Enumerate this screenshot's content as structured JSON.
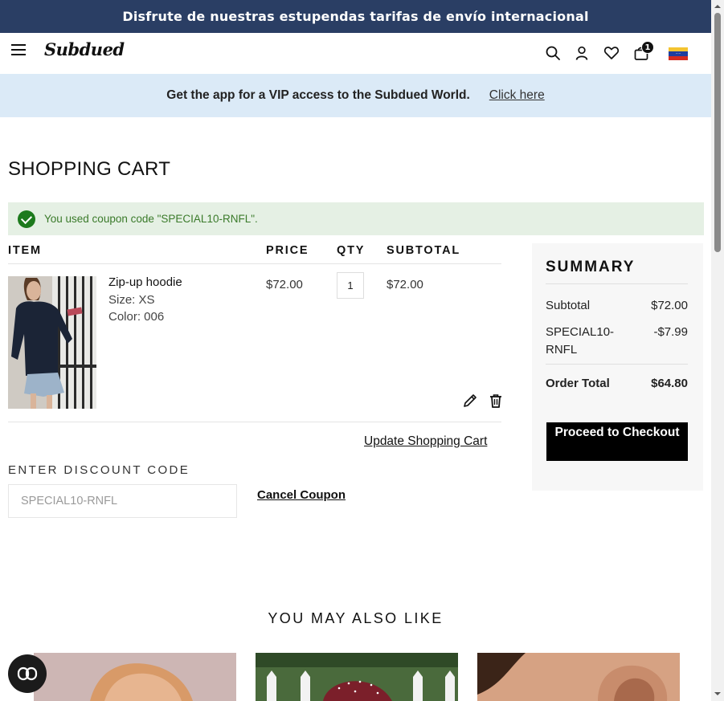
{
  "announcement": "Disfrute de nuestras estupendas tarifas de envío internacional",
  "header": {
    "logo": "Subdued",
    "cart_count": "1",
    "flag_colors": [
      "#f4c430",
      "#1f3e9e",
      "#d52b1e"
    ]
  },
  "app_banner": {
    "text": "Get the app for a VIP access to the Subdued World.",
    "link": "Click here"
  },
  "page": {
    "title": "SHOPPING CART"
  },
  "message": "You used coupon code \"SPECIAL10-RNFL\".",
  "table": {
    "headers": [
      "ITEM",
      "PRICE",
      "QTY",
      "SUBTOTAL"
    ],
    "items": [
      {
        "name": "Zip-up hoodie",
        "size": "Size: XS",
        "color": "Color: 006",
        "price": "$72.00",
        "qty": "1",
        "subtotal": "$72.00"
      }
    ],
    "update_label": "Update Shopping Cart"
  },
  "discount": {
    "title": "ENTER DISCOUNT CODE",
    "value": "SPECIAL10-RNFL",
    "cancel_label": "Cancel Coupon"
  },
  "summary": {
    "title": "SUMMARY",
    "subtotal_label": "Subtotal",
    "subtotal_value": "$72.00",
    "discount_label": "SPECIAL10-\nRNFL",
    "discount_value": "-$7.99",
    "total_label": "Order Total",
    "total_value": "$64.80",
    "checkout_label": "Proceed to Checkout"
  },
  "recommendations": {
    "title": "YOU MAY ALSO LIKE"
  },
  "colors": {
    "topbar": "#2a3e64",
    "banner": "#dbeaf7",
    "success_bg": "#e5f0e4",
    "success_icon": "#1d7a1d"
  }
}
